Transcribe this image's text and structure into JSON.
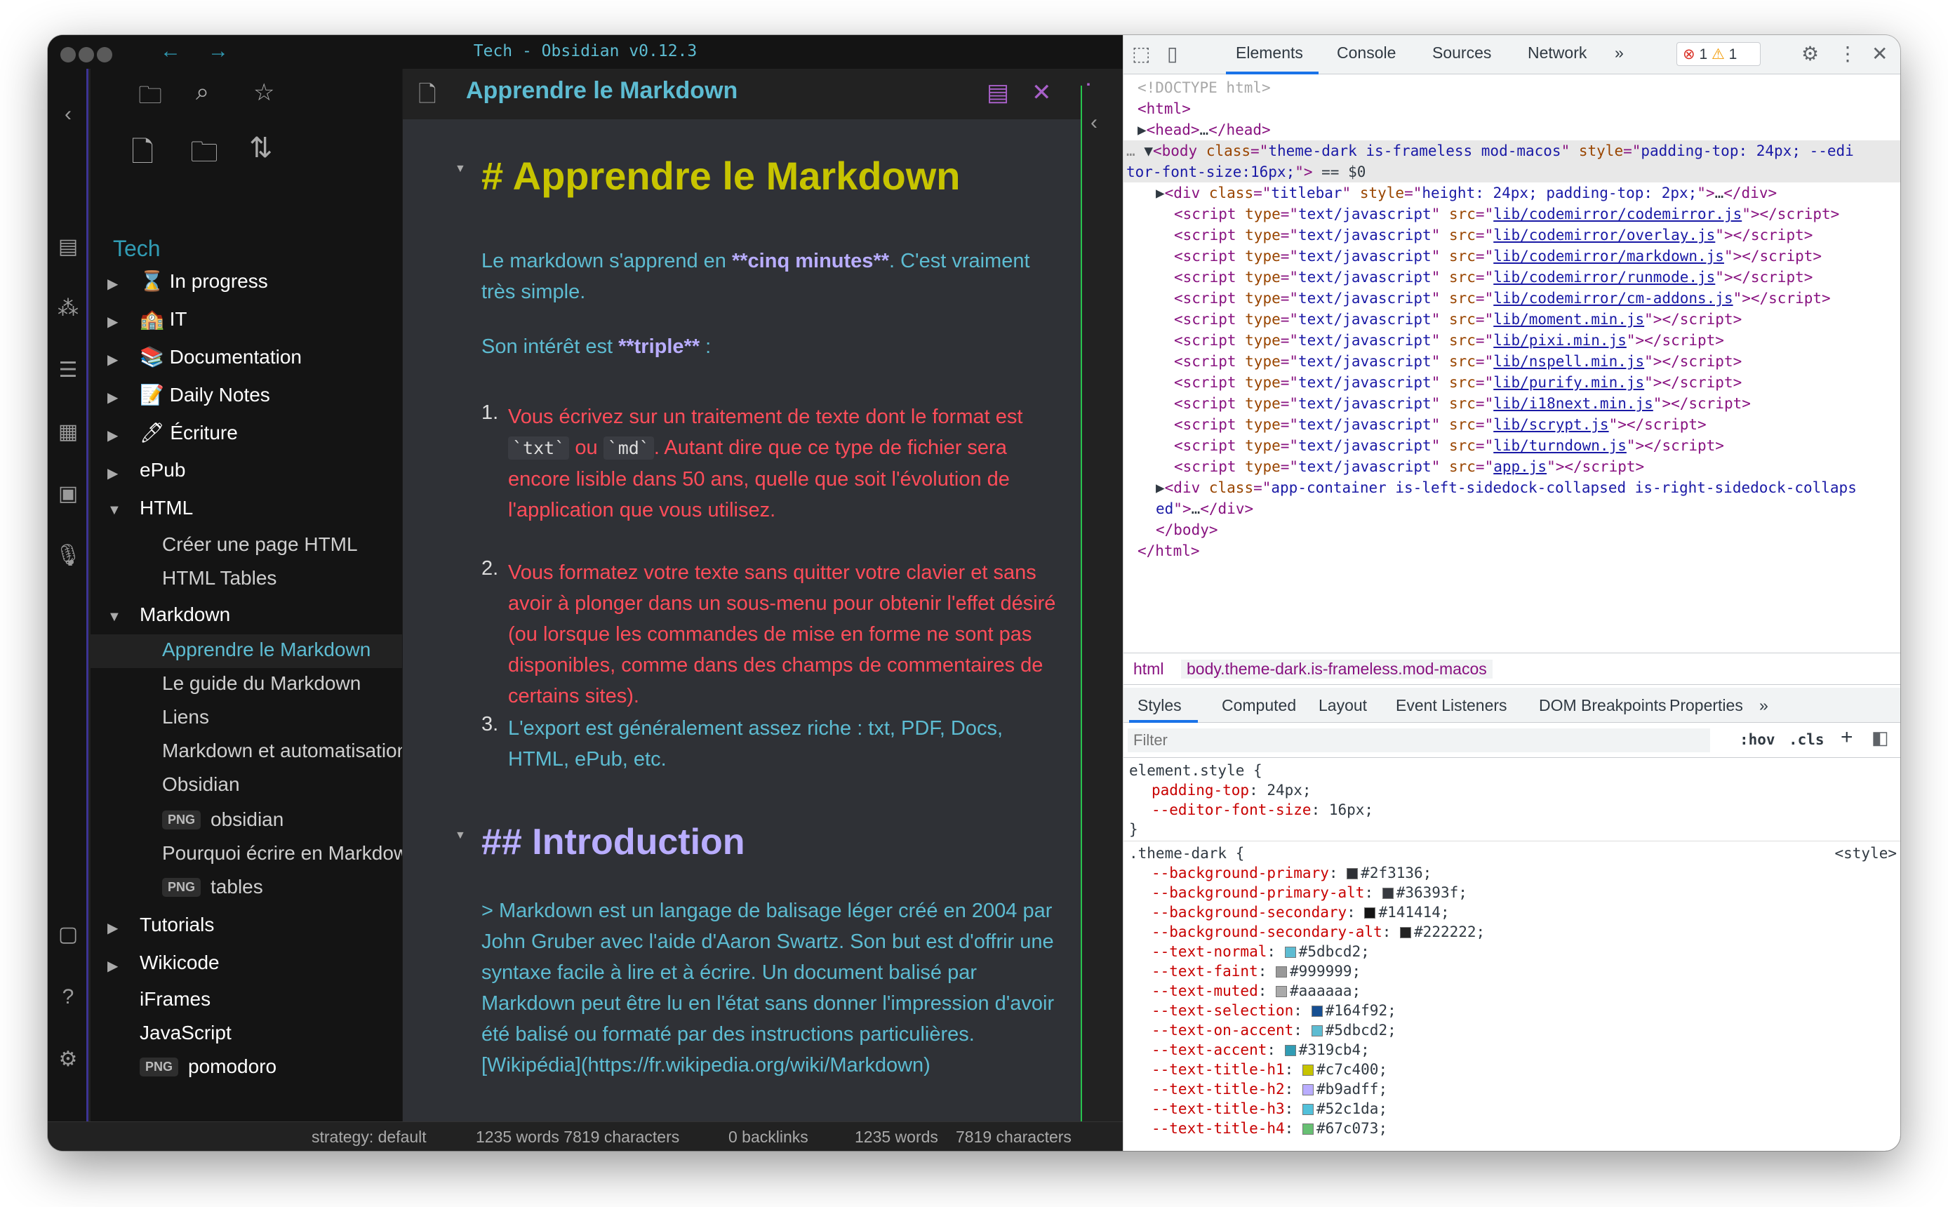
{
  "window_title": "Tech - Obsidian v0.12.3",
  "nav": {
    "back": "←",
    "forward": "→"
  },
  "vault_name": "Tech",
  "tree": [
    {
      "label": "⌛ In progress",
      "type": "folder",
      "arrow": "▶"
    },
    {
      "label": "🏫 IT",
      "type": "folder",
      "arrow": "▶"
    },
    {
      "label": "📚 Documentation",
      "type": "folder",
      "arrow": "▶"
    },
    {
      "label": "📝 Daily Notes",
      "type": "folder",
      "arrow": "▶"
    },
    {
      "label": "🖊 Écriture",
      "type": "folder",
      "arrow": "▶"
    },
    {
      "label": "ePub",
      "type": "folder",
      "arrow": "▶"
    },
    {
      "label": "HTML",
      "type": "folder",
      "arrow": "▼"
    },
    {
      "label": "Créer une page HTML",
      "type": "file"
    },
    {
      "label": "HTML Tables",
      "type": "file"
    },
    {
      "label": "Markdown",
      "type": "folder",
      "arrow": "▼"
    },
    {
      "label": "Apprendre le Markdown",
      "type": "file",
      "active": true
    },
    {
      "label": "Le guide du Markdown",
      "type": "file"
    },
    {
      "label": "Liens",
      "type": "file"
    },
    {
      "label": "Markdown et automatisation",
      "type": "file"
    },
    {
      "label": "Obsidian",
      "type": "file"
    },
    {
      "label": "obsidian",
      "type": "png"
    },
    {
      "label": "Pourquoi écrire en Markdown",
      "type": "file"
    },
    {
      "label": "tables",
      "type": "png"
    },
    {
      "label": "Tutorials",
      "type": "folder",
      "arrow": "▶"
    },
    {
      "label": "Wikicode",
      "type": "folder",
      "arrow": "▶"
    },
    {
      "label": "iFrames",
      "type": "rootfile"
    },
    {
      "label": "JavaScript",
      "type": "rootfile"
    },
    {
      "label": "pomodoro",
      "type": "rootpng"
    }
  ],
  "png_badge": "PNG",
  "editor": {
    "tab_title": "Apprendre le Markdown",
    "h1": "# Apprendre le Markdown",
    "p1_a": "Le markdown s'apprend en ",
    "p1_b": "**cinq minutes**",
    "p1_c": ". C'est vraiment très simple.",
    "p2_a": "Son intérêt est ",
    "p2_b": "**triple**",
    "p2_c": " :",
    "li1_num": "1.",
    "li1_a": "Vous écrivez sur un traitement de texte dont le format est ",
    "li1_code1": "`txt`",
    "li1_or": " ou ",
    "li1_code2": "`md`",
    "li1_b": ". Autant dire que ce type de fichier sera encore lisible dans 50 ans, quelle que soit l'évolution de l'application que vous utilisez.",
    "li2_num": "2.",
    "li2": "Vous formatez votre texte sans quitter votre clavier et sans avoir à plonger dans un sous-menu pour obtenir l'effet désiré (ou lorsque les commandes de mise en forme ne sont pas disponibles, comme dans des champs de commentaires de certains sites).",
    "li3_num": "3.",
    "li3": "L'export est généralement assez riche : txt, PDF, Docs, HTML, ePub, etc.",
    "h2": "## Introduction",
    "quote": "> Markdown est un langage de balisage léger créé en 2004 par John Gruber avec l'aide d'Aaron Swartz. Son but est d'offrir une syntaxe facile à lire et à écrire. Un document balisé par Markdown peut être lu en l'état sans donner l'impression d'avoir été balisé ou formaté par des instructions particulières. [Wikipédia](https://fr.wikipedia.org/wiki/Markdown)"
  },
  "status": {
    "strategy": "strategy: default",
    "counts1": "1235 words 7819 characters",
    "backlinks": "0 backlinks",
    "words": "1235 words",
    "chars": "7819 characters"
  },
  "devtools": {
    "tabs": [
      "Elements",
      "Console",
      "Sources",
      "Network",
      "»"
    ],
    "errors": "1",
    "warnings": "1",
    "dom": [
      {
        "indent": 0,
        "html": "<span class='dm'>&lt;!DOCTYPE html&gt;</span>"
      },
      {
        "indent": 0,
        "html": "&lt;html&gt;"
      },
      {
        "indent": 0,
        "html": "<span class='t'>▶</span>&lt;head&gt;<span class='t'>…</span>&lt;/head&gt;"
      },
      {
        "indent": -1,
        "html": "<span class='g'>…</span> <span class='t'>▼</span>&lt;body <span class='a'>class</span>=\"<span class='v'>theme-dark is-frameless mod-macos</span>\" <span class='a'>style</span>=\"<span class='v'>padding-top: 24px; --edi</span>",
        "sel": true
      },
      {
        "indent": -1,
        "html": "<span class='v'>tor-font-size:16px;</span>\"&gt; <span class='t'>== $0</span>",
        "sel": true
      },
      {
        "indent": 1,
        "html": "<span class='t'>▶</span>&lt;div <span class='a'>class</span>=\"<span class='v'>titlebar</span>\" <span class='a'>style</span>=\"<span class='v'>height: 24px; padding-top: 2px;</span>\"&gt;<span class='t'>…</span>&lt;/div&gt;"
      },
      {
        "indent": 2,
        "src": "lib/codemirror/codemirror.js"
      },
      {
        "indent": 2,
        "src": "lib/codemirror/overlay.js"
      },
      {
        "indent": 2,
        "src": "lib/codemirror/markdown.js"
      },
      {
        "indent": 2,
        "src": "lib/codemirror/runmode.js"
      },
      {
        "indent": 2,
        "src": "lib/codemirror/cm-addons.js"
      },
      {
        "indent": 2,
        "src": "lib/moment.min.js"
      },
      {
        "indent": 2,
        "src": "lib/pixi.min.js"
      },
      {
        "indent": 2,
        "src": "lib/nspell.min.js"
      },
      {
        "indent": 2,
        "src": "lib/purify.min.js"
      },
      {
        "indent": 2,
        "src": "lib/i18next.min.js"
      },
      {
        "indent": 2,
        "src": "lib/scrypt.js"
      },
      {
        "indent": 2,
        "src": "lib/turndown.js"
      },
      {
        "indent": 2,
        "src": "app.js"
      },
      {
        "indent": 1,
        "html": "<span class='t'>▶</span>&lt;div <span class='a'>class</span>=\"<span class='v'>app-container is-left-sidedock-collapsed is-right-sidedock-collaps</span>"
      },
      {
        "indent": 1,
        "html": "<span class='v'>ed</span>\"&gt;<span class='t'>…</span>&lt;/div&gt;"
      },
      {
        "indent": 1,
        "html": "&lt;/body&gt;"
      },
      {
        "indent": 0,
        "html": "&lt;/html&gt;"
      }
    ],
    "crumb_html": "html",
    "crumb_body": "body.theme-dark.is-frameless.mod-macos",
    "subtabs": [
      "Styles",
      "Computed",
      "Layout",
      "Event Listeners",
      "DOM Breakpoints",
      "Properties",
      "»"
    ],
    "filter_placeholder": "Filter",
    "hov": ":hov",
    "cls": ".cls",
    "element_style_selector": "element.style {",
    "element_style": [
      {
        "prop": "padding-top",
        "val": "24px;"
      },
      {
        "prop": "--editor-font-size",
        "val": "16px;"
      }
    ],
    "theme_selector": ".theme-dark {",
    "style_source": "<style>",
    "theme_vars": [
      {
        "prop": "--background-primary",
        "color": "#2f3136",
        "val": "#2f3136;"
      },
      {
        "prop": "--background-primary-alt",
        "color": "#36393f",
        "val": "#36393f;"
      },
      {
        "prop": "--background-secondary",
        "color": "#141414",
        "val": "#141414;"
      },
      {
        "prop": "--background-secondary-alt",
        "color": "#222222",
        "val": "#222222;"
      },
      {
        "prop": "--text-normal",
        "color": "#5dbcd2",
        "val": "#5dbcd2;"
      },
      {
        "prop": "--text-faint",
        "color": "#999999",
        "val": "#999999;"
      },
      {
        "prop": "--text-muted",
        "color": "#aaaaaa",
        "val": "#aaaaaa;"
      },
      {
        "prop": "--text-selection",
        "color": "#164f92",
        "val": "#164f92;"
      },
      {
        "prop": "--text-on-accent",
        "color": "#5dbcd2",
        "val": "#5dbcd2;"
      },
      {
        "prop": "--text-accent",
        "color": "#319cb4",
        "val": "#319cb4;"
      },
      {
        "prop": "--text-title-h1",
        "color": "#c7c400",
        "val": "#c7c400;"
      },
      {
        "prop": "--text-title-h2",
        "color": "#b9adff",
        "val": "#b9adff;"
      },
      {
        "prop": "--text-title-h3",
        "color": "#52c1da",
        "val": "#52c1da;"
      },
      {
        "prop": "--text-title-h4",
        "color": "#67c073",
        "val": "#67c073;"
      }
    ],
    "close_brace": "}"
  }
}
